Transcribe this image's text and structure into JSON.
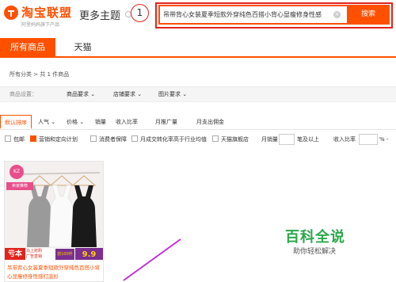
{
  "header": {
    "logo_title": "淘宝联盟",
    "logo_subtitle": "阿里妈妈旗下产品",
    "more_topics": "更多主题",
    "step_number": "1",
    "search_value": "吊带背心女装夏季短款外穿纯色百搭小背心显瘦修身性感",
    "search_button": "搜索",
    "clear_symbol": "×"
  },
  "tabs": [
    {
      "label": "所有商品"
    },
    {
      "label": "天猫"
    }
  ],
  "breadcrumb": "所有分类 > 共 1 件商品",
  "filters": {
    "label": "商品设置：",
    "dropdowns": [
      "商品要求",
      "店铺要求",
      "图片要求"
    ]
  },
  "sort": {
    "items": [
      "默认排序",
      "人气",
      "价格",
      "销量",
      "收入比率",
      "月推广量",
      "月支出佣金"
    ]
  },
  "options": {
    "items": [
      {
        "label": "包邮",
        "checked": false
      },
      {
        "label": "营销和定向计划",
        "checked": true
      },
      {
        "label": "消费者保障",
        "checked": false
      },
      {
        "label": "月成交转化率高于行业均值",
        "checked": false
      },
      {
        "label": "天猫旗舰店",
        "checked": false
      }
    ],
    "sales_label": "月销量",
    "sales_suffix": "笔及以上",
    "rate_label": "收入比率",
    "rate_suffix": "% -"
  },
  "product": {
    "shop_logo": "KZ",
    "shop_tag": "卖家推荐",
    "promo_left": "亏本",
    "promo_mid_line1": "马上抢购",
    "promo_mid_line2": "广告直销",
    "promo_coupon": "前100件",
    "promo_price": "9.9",
    "title": "吊带背心女装夏季短款外穿纯色百搭小背心显瘦修身性感打底衫"
  },
  "watermark": {
    "title": "百科全说",
    "subtitle": "助你轻松解决"
  },
  "colors": {
    "accent": "#ff5000",
    "highlight_red": "#e3241b",
    "watermark_green": "#2aa84a"
  }
}
